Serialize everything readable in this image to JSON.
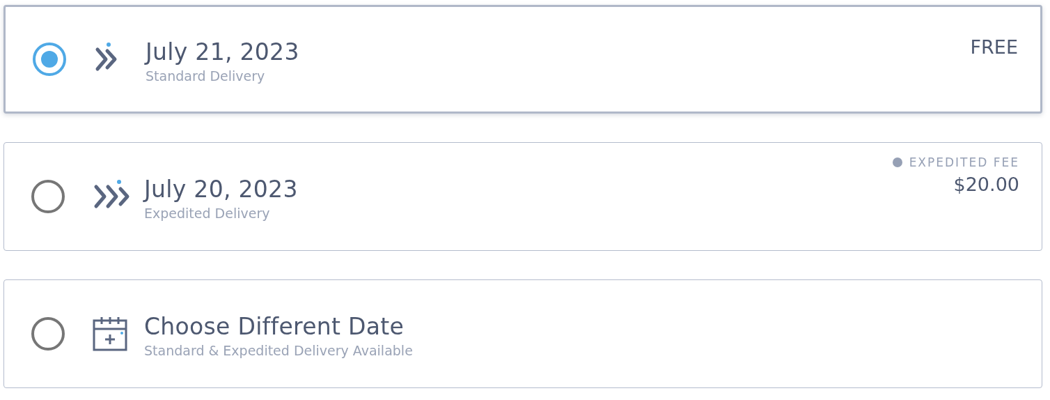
{
  "options": [
    {
      "kind": "standard",
      "selected": true,
      "title": "July 21, 2023",
      "subtitle": "Standard Delivery",
      "price": "FREE"
    },
    {
      "kind": "expedited",
      "selected": false,
      "title": "July 20, 2023",
      "subtitle": "Expedited Delivery",
      "fee_label": "EXPEDITED FEE",
      "price": "$20.00"
    },
    {
      "kind": "calendar",
      "selected": false,
      "title": "Choose Different Date",
      "subtitle": "Standard & Expedited Delivery Available"
    }
  ]
}
